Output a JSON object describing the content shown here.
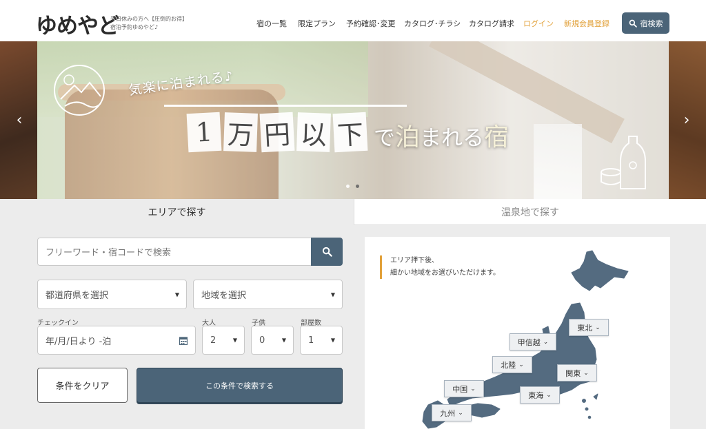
{
  "header": {
    "logo": "ゆめやど",
    "tagline_1": "平日休みの方へ【圧倒的お得】",
    "tagline_2": "宿泊予約ゆめやど♪",
    "nav": [
      "宿の一覧",
      "限定プラン",
      "予約確認･変更",
      "カタログ･チラシ",
      "カタログ請求"
    ],
    "login": "ログイン",
    "register": "新規会員登録",
    "search_button": "宿検索",
    "colors": {
      "accent": "#e2a13a",
      "primary": "#4b6478"
    }
  },
  "hero": {
    "slogan_small": "気楽に泊まれる♪",
    "slogan_cards": [
      "1",
      "万",
      "円",
      "以",
      "下"
    ],
    "slogan_tail_1": "で",
    "slogan_tail_big_1": "泊",
    "slogan_tail_2": "まれる",
    "slogan_tail_big_2": "宿",
    "prev_arrow": "‹",
    "next_arrow": "›",
    "slide_count": 2,
    "active_slide": 2
  },
  "tabs": {
    "area": "エリアで探す",
    "onsen": "温泉地で探す"
  },
  "search": {
    "keyword_placeholder": "フリーワード・宿コードで検索",
    "prefecture": "都道府県を選択",
    "region": "地域を選択",
    "checkin_label": "チェックイン",
    "checkin_value": "年/月/日より -泊",
    "adults_label": "大人",
    "adults_value": "2",
    "children_label": "子供",
    "children_value": "0",
    "rooms_label": "部屋数",
    "rooms_value": "1",
    "clear_button": "条件をクリア",
    "submit_button": "この条件で検索する"
  },
  "map": {
    "note_1": "エリア押下後、",
    "note_2": "細かい地域をお選びいただけます。",
    "regions": {
      "tohoku": "東北",
      "koshinetsu": "甲信越",
      "hokuriku": "北陸",
      "kanto": "関東",
      "chugoku": "中国",
      "tokai": "東海",
      "kyushu": "九州"
    },
    "chevron": "⌄"
  }
}
